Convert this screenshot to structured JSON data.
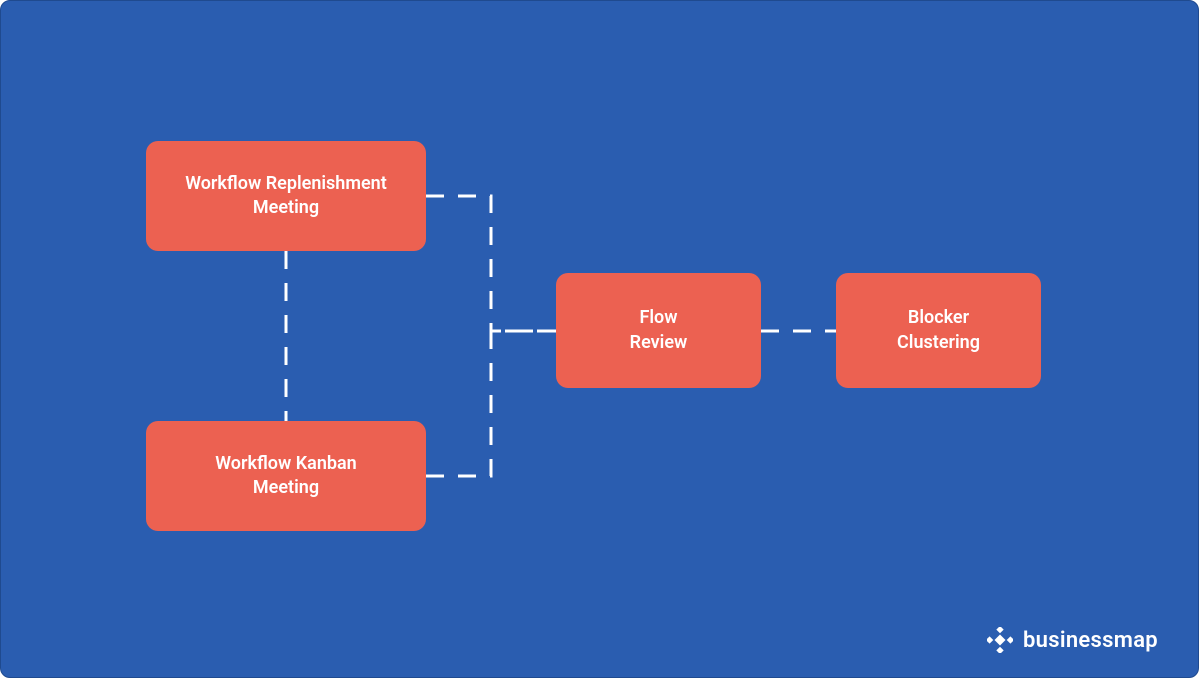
{
  "diagram": {
    "nodes": {
      "replenishment": "Workflow Replenishment\nMeeting",
      "kanban": "Workflow Kanban\nMeeting",
      "flow_review": "Flow\nReview",
      "blocker_clustering": "Blocker\nClustering"
    },
    "connectors": [
      {
        "from": "replenishment",
        "to": "kanban",
        "style": "vertical-dashed"
      },
      {
        "from": "replenishment",
        "to": "flow_review",
        "style": "elbow-dashed"
      },
      {
        "from": "kanban",
        "to": "flow_review",
        "style": "elbow-dashed"
      },
      {
        "from": "flow_review",
        "to": "blocker_clustering",
        "style": "horizontal-dashed"
      }
    ]
  },
  "branding": {
    "name": "businessmap",
    "icon": "diamond-plus-icon"
  },
  "colors": {
    "background": "#2a5db0",
    "node": "#ec6151",
    "node_text": "#ffffff",
    "connector": "#ffffff"
  }
}
